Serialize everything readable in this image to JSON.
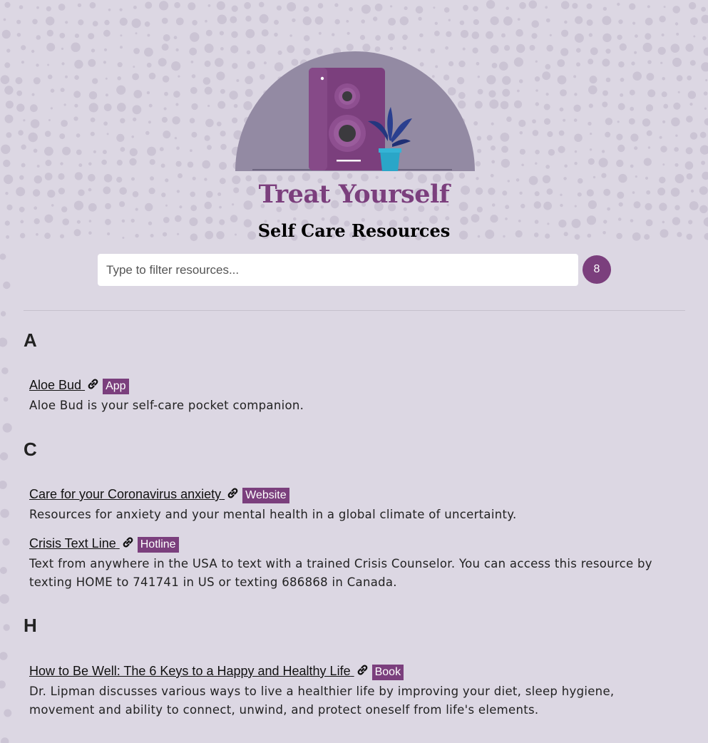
{
  "header": {
    "title": "Treat Yourself",
    "subtitle": "Self Care Resources"
  },
  "search": {
    "placeholder": "Type to filter resources...",
    "value": "",
    "result_count": "8"
  },
  "colors": {
    "background": "#dcd7e3",
    "accent": "#7b3f7d",
    "hero_circle": "#938aa3",
    "plant": "#2a3f8f",
    "pot": "#2aa6c8"
  },
  "sections": [
    {
      "letter": "A",
      "items": [
        {
          "name": "Aloe Bud",
          "tag": "App",
          "description": "Aloe Bud is your self-care pocket companion."
        }
      ]
    },
    {
      "letter": "C",
      "items": [
        {
          "name": "Care for your Coronavirus anxiety",
          "tag": "Website",
          "description": "Resources for anxiety and your mental health in a global climate of uncertainty."
        },
        {
          "name": "Crisis Text Line",
          "tag": "Hotline",
          "description": "Text from anywhere in the USA to text with a trained Crisis Counselor. You can access this resource by texting HOME to 741741 in US or texting 686868 in Canada."
        }
      ]
    },
    {
      "letter": "H",
      "items": [
        {
          "name": "How to Be Well: The 6 Keys to a Happy and Healthy Life",
          "tag": "Book",
          "description": "Dr. Lipman discusses various ways to live a healthier life by improving your diet, sleep hygiene, movement and ability to connect, unwind, and protect oneself from life's elements."
        }
      ]
    }
  ],
  "icons": {
    "link": "link-icon",
    "speaker": "speaker-icon",
    "plant": "plant-icon"
  }
}
